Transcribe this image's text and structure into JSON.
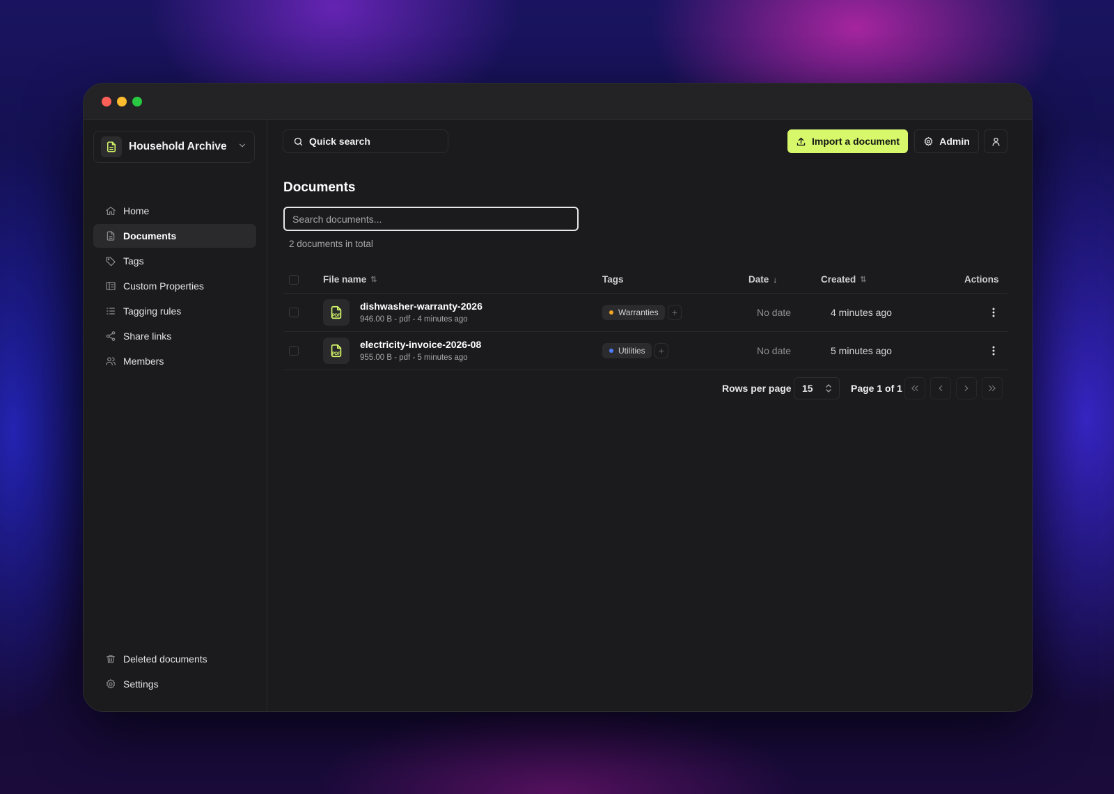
{
  "window": {
    "controls": [
      "close",
      "minimize",
      "maximize"
    ]
  },
  "sidebar": {
    "org_name": "Household Archive",
    "items": [
      {
        "label": "Home",
        "icon": "home-icon"
      },
      {
        "label": "Documents",
        "icon": "document-icon",
        "active": true
      },
      {
        "label": "Tags",
        "icon": "tag-icon"
      },
      {
        "label": "Custom Properties",
        "icon": "properties-icon"
      },
      {
        "label": "Tagging rules",
        "icon": "list-check-icon"
      },
      {
        "label": "Share links",
        "icon": "share-icon"
      },
      {
        "label": "Members",
        "icon": "users-icon"
      }
    ],
    "bottom_items": [
      {
        "label": "Deleted documents",
        "icon": "trash-icon"
      },
      {
        "label": "Settings",
        "icon": "gear-icon"
      }
    ]
  },
  "header": {
    "quick_search_label": "Quick search",
    "import_label": "Import a document",
    "admin_label": "Admin"
  },
  "main": {
    "title": "Documents",
    "search_placeholder": "Search documents...",
    "count_text": "2 documents in total",
    "columns": {
      "file_name": "File name",
      "tags": "Tags",
      "date": "Date",
      "created": "Created",
      "actions": "Actions"
    },
    "rows": [
      {
        "name": "dishwasher-warranty-2026",
        "meta": "946.00 B - pdf - 4 minutes ago",
        "tag": "Warranties",
        "tag_color": "#f5a524",
        "date": "No date",
        "created": "4 minutes ago"
      },
      {
        "name": "electricity-invoice-2026-08",
        "meta": "955.00 B - pdf - 5 minutes ago",
        "tag": "Utilities",
        "tag_color": "#4f7cff",
        "date": "No date",
        "created": "5 minutes ago"
      }
    ],
    "pagination": {
      "rows_per_page_label": "Rows per page",
      "rows_per_page_value": "15",
      "page_info": "Page 1 of 1"
    }
  },
  "colors": {
    "accent": "#d6f86a",
    "background": "#1b1b1d"
  }
}
